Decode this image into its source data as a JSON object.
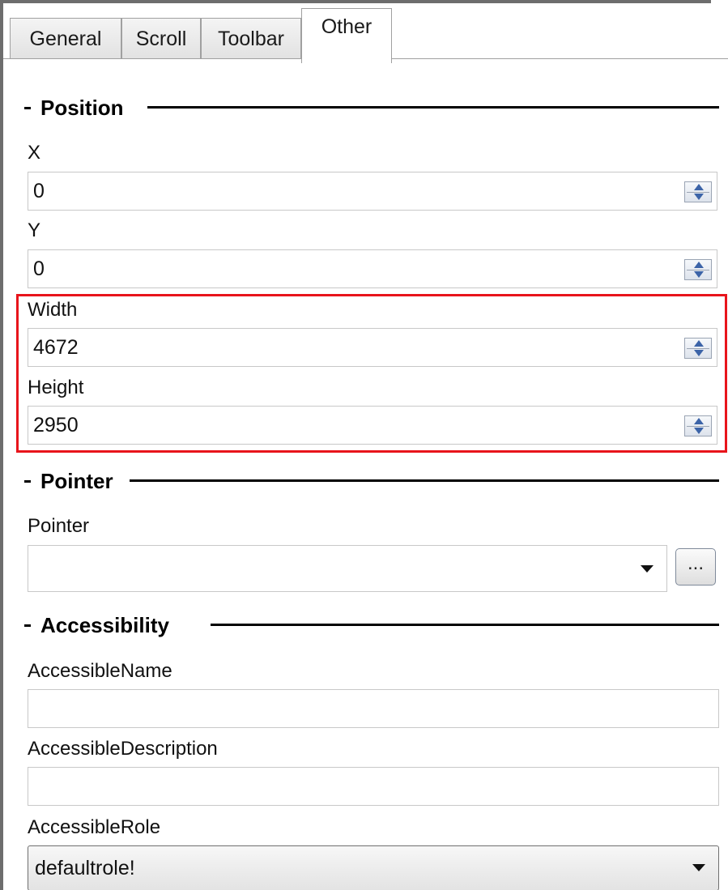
{
  "tabs": [
    {
      "label": "General",
      "active": false
    },
    {
      "label": "Scroll",
      "active": false
    },
    {
      "label": "Toolbar",
      "active": false
    },
    {
      "label": "Other",
      "active": true
    }
  ],
  "position": {
    "title": "Position",
    "x_label": "X",
    "x_value": "0",
    "y_label": "Y",
    "y_value": "0",
    "width_label": "Width",
    "width_value": "4672",
    "height_label": "Height",
    "height_value": "2950"
  },
  "pointer": {
    "title": "Pointer",
    "label": "Pointer",
    "value": "",
    "browse_label": "..."
  },
  "accessibility": {
    "title": "Accessibility",
    "name_label": "AccessibleName",
    "name_value": "",
    "description_label": "AccessibleDescription",
    "description_value": "",
    "role_label": "AccessibleRole",
    "role_value": "defaultrole!"
  },
  "colors": {
    "highlight": "#e8141b",
    "spinner_arrow": "#3c64a8"
  }
}
